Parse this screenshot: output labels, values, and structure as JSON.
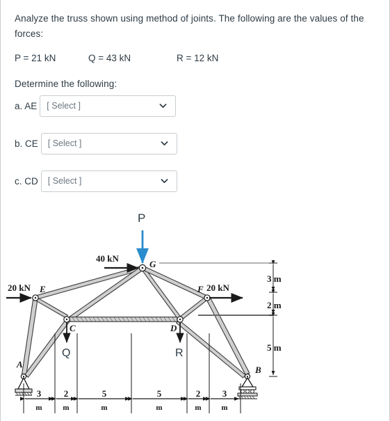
{
  "question": {
    "prompt_line1": "Analyze the truss shown using method of joints. The following are the values of",
    "prompt_line2": "the forces:",
    "forces": [
      {
        "label": "P = 21 kN"
      },
      {
        "label": "Q = 43 kN"
      },
      {
        "label": "R = 12 kN"
      }
    ],
    "determine_label": "Determine the following:"
  },
  "answers": [
    {
      "prefix": "a. AE",
      "placeholder": "[ Select ]",
      "value": "[ Select ]"
    },
    {
      "prefix": "b. CE",
      "placeholder": "[ Select ]",
      "value": "[ Select ]"
    },
    {
      "prefix": "c. CD",
      "placeholder": "[ Select ]",
      "value": "[ Select ]"
    }
  ],
  "figure": {
    "title": "truss-diagram",
    "joint_labels": {
      "A": "A",
      "B": "B",
      "C": "C",
      "D": "D",
      "E": "E",
      "F": "F",
      "G": "G"
    },
    "applied_loads": [
      {
        "name": "load-P",
        "label": "P",
        "direction": "down",
        "color": "#2b8ccd",
        "at_joint": "G"
      },
      {
        "name": "load-Q",
        "label": "Q",
        "direction": "down",
        "color": "#1a1a1a",
        "at_joint": "C"
      },
      {
        "name": "load-R",
        "label": "R",
        "direction": "down",
        "color": "#1a1a1a",
        "at_joint": "D"
      },
      {
        "name": "load-40kN",
        "label": "40 kN",
        "direction": "right",
        "color": "#1a1a1a",
        "at_joint": "G"
      },
      {
        "name": "load-20kN-left",
        "label": "20 kN",
        "direction": "right",
        "color": "#1a1a1a",
        "at_joint": "E"
      },
      {
        "name": "load-20kN-right",
        "label": "20 kN",
        "direction": "right",
        "color": "#1a1a1a",
        "at_joint": "F"
      }
    ],
    "vertical_dimensions": [
      {
        "label": "3 m"
      },
      {
        "label": "2 m"
      },
      {
        "label": "5 m"
      }
    ],
    "horizontal_dimensions": [
      {
        "num": "3",
        "unit": "m"
      },
      {
        "num": "2",
        "unit": "m"
      },
      {
        "num": "5",
        "unit": "m"
      },
      {
        "num": "5",
        "unit": "m"
      },
      {
        "num": "2",
        "unit": "m"
      },
      {
        "num": "3",
        "unit": "m"
      }
    ],
    "supports": [
      {
        "name": "pin-support",
        "at_joint": "A",
        "type": "pin"
      },
      {
        "name": "roller-support",
        "at_joint": "B",
        "type": "roller"
      }
    ]
  },
  "colors": {
    "text": "#2d3b45",
    "border": "#c7cdd1",
    "placeholder": "#6b7780",
    "accent_blue": "#2b8ccd",
    "member": "#3a3a3a"
  }
}
